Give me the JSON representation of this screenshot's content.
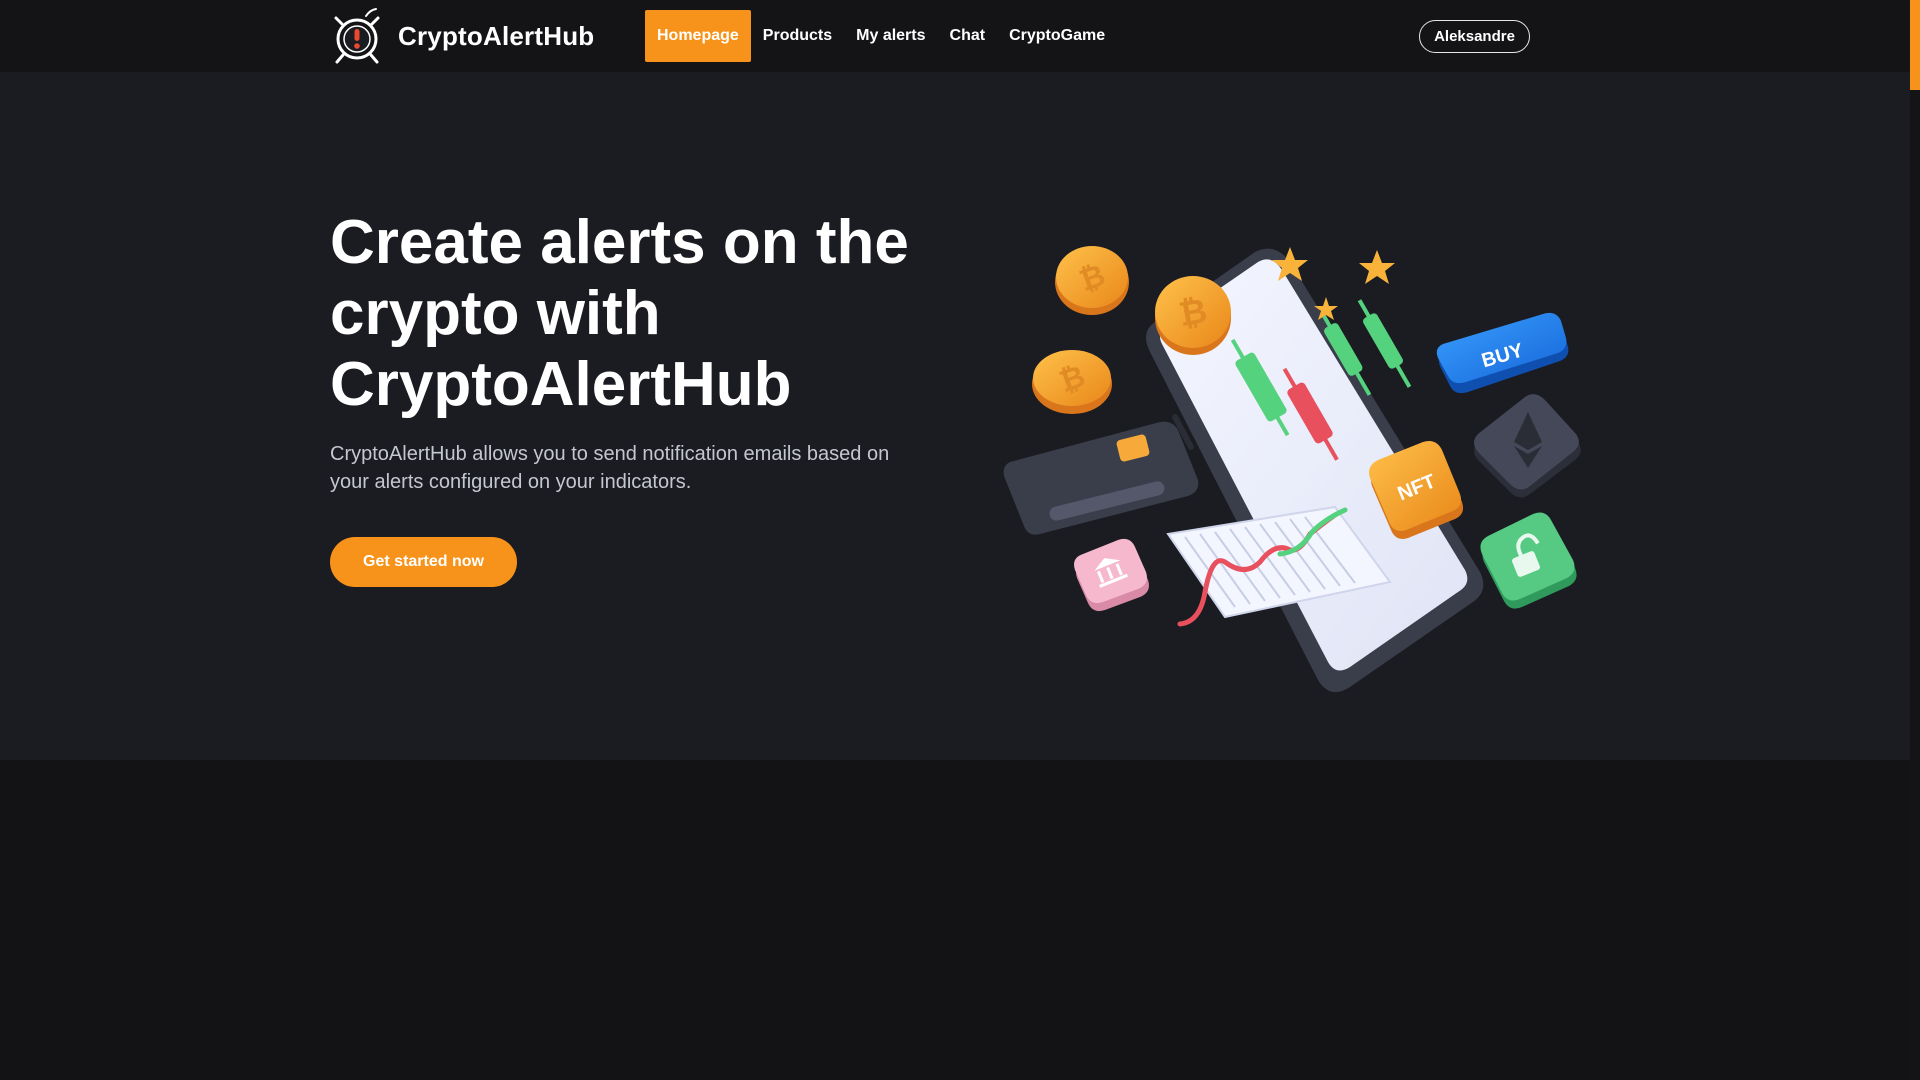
{
  "header": {
    "brand": "CryptoAlertHub",
    "nav": [
      {
        "label": "Homepage",
        "active": true
      },
      {
        "label": "Products",
        "active": false
      },
      {
        "label": "My alerts",
        "active": false
      },
      {
        "label": "Chat",
        "active": false
      },
      {
        "label": "CryptoGame",
        "active": false
      }
    ],
    "user": "Aleksandre"
  },
  "hero": {
    "title": "Create alerts on the crypto with CryptoAlertHub",
    "description": "CryptoAlertHub allows you to send notification emails based on your alerts configured on your indicators.",
    "cta": "Get started now",
    "illustration": {
      "buy_label": "BUY",
      "nft_label": "NFT",
      "icons": [
        "bitcoin-coin-icon",
        "star-icon",
        "ethereum-icon",
        "lock-icon",
        "bank-icon",
        "credit-card-icon",
        "candlestick-chart-icon",
        "line-chart-icon",
        "smartphone-icon"
      ]
    }
  },
  "colors": {
    "accent": "#f7931a",
    "header_bg": "#141417",
    "hero_bg": "#1b1c21",
    "page_bg": "#131316"
  }
}
